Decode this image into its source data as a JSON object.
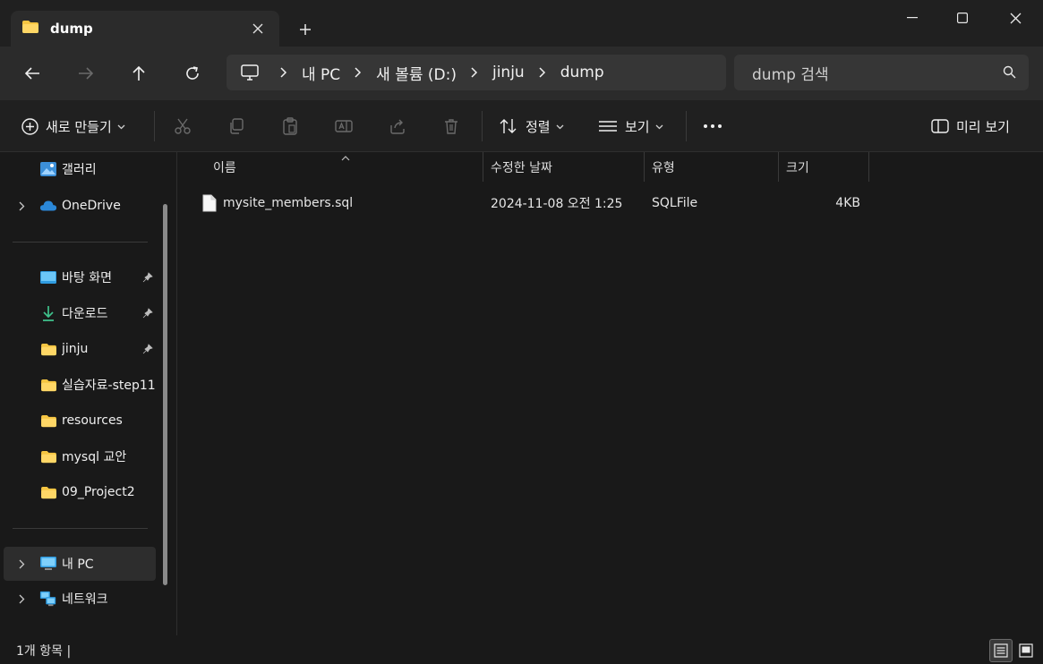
{
  "tab": {
    "title": "dump"
  },
  "address": {
    "crumbs": [
      "내 PC",
      "새 볼륨 (D:)",
      "jinju",
      "dump"
    ]
  },
  "search": {
    "placeholder": "dump 검색"
  },
  "commandbar": {
    "new_label": "새로 만들기",
    "sort_label": "정렬",
    "view_label": "보기",
    "preview_label": "미리 보기"
  },
  "sidebar": {
    "items": [
      {
        "label": "갤러리"
      },
      {
        "label": "OneDrive"
      },
      {
        "label": "바탕 화면"
      },
      {
        "label": "다운로드"
      },
      {
        "label": "jinju"
      },
      {
        "label": "실습자료-step11"
      },
      {
        "label": "resources"
      },
      {
        "label": "mysql 교안"
      },
      {
        "label": "09_Project2"
      },
      {
        "label": "내 PC"
      },
      {
        "label": "네트워크"
      }
    ]
  },
  "columns": {
    "name": "이름",
    "modified": "수정한 날짜",
    "type": "유형",
    "size": "크기"
  },
  "files": [
    {
      "name": "mysite_members.sql",
      "modified": "2024-11-08 오전 1:25",
      "type": "SQLFile",
      "size": "4KB"
    }
  ],
  "status": {
    "text": "1개 항목  |"
  },
  "colors": {
    "folder": "#f5c542",
    "onedrive": "#2b88d8",
    "accent_blue": "#4cc2ff"
  }
}
